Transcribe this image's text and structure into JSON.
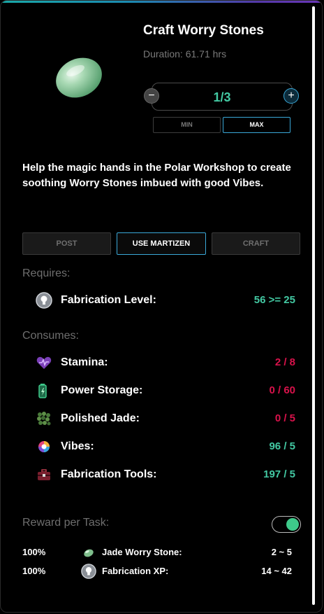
{
  "header": {
    "title": "Craft Worry Stones",
    "duration": "Duration: 61.71 hrs"
  },
  "stepper": {
    "value": "1/3",
    "minus_label": "−",
    "plus_label": "+",
    "min_label": "MIN",
    "max_label": "MAX"
  },
  "description": "Help the magic hands in the Polar Workshop to create soothing Worry Stones imbued with good Vibes.",
  "actions": {
    "post_label": "POST",
    "use_label": "USE MARTIZEN",
    "craft_label": "CRAFT"
  },
  "requires": {
    "label": "Requires:",
    "items": [
      {
        "icon": "lightbulb-icon",
        "name": "Fabrication Level:",
        "value": "56 >= 25",
        "status": "ok"
      }
    ]
  },
  "consumes": {
    "label": "Consumes:",
    "items": [
      {
        "icon": "heart-icon",
        "name": "Stamina:",
        "value": "2 / 8",
        "status": "insufficient"
      },
      {
        "icon": "battery-icon",
        "name": "Power Storage:",
        "value": "0 / 60",
        "status": "insufficient"
      },
      {
        "icon": "jade-icon",
        "name": "Polished Jade:",
        "value": "0 / 5",
        "status": "insufficient"
      },
      {
        "icon": "vibes-icon",
        "name": "Vibes:",
        "value": "96 / 5",
        "status": "ok"
      },
      {
        "icon": "toolbox-icon",
        "name": "Fabrication Tools:",
        "value": "197 / 5",
        "status": "ok"
      }
    ]
  },
  "reward": {
    "label": "Reward per Task:",
    "toggle_on": true,
    "items": [
      {
        "percent": "100%",
        "icon": "jade-stone-icon",
        "name": "Jade Worry Stone:",
        "range": "2 ~ 5"
      },
      {
        "percent": "100%",
        "icon": "lightbulb-icon",
        "name": "Fabrication XP:",
        "range": "14 ~ 42"
      }
    ]
  },
  "colors": {
    "accent": "#3aa8d8",
    "ok": "#43c9a3",
    "insufficient": "#d9124b",
    "muted": "#6e6e6e"
  }
}
